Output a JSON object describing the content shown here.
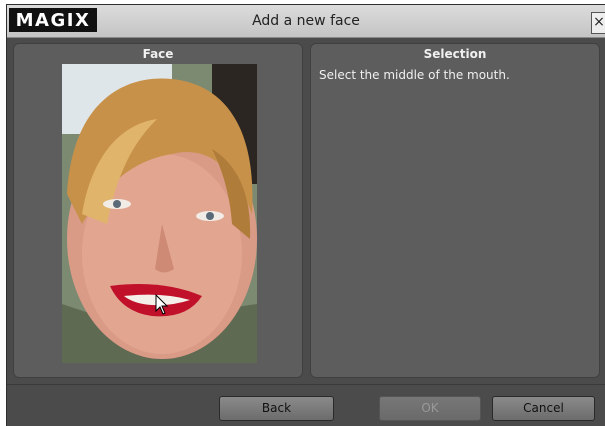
{
  "window": {
    "logo": "MAGIX",
    "title": "Add a new face",
    "close_glyph": "×"
  },
  "face_panel": {
    "title": "Face"
  },
  "selection_panel": {
    "title": "Selection",
    "instruction": "Select the middle of the mouth."
  },
  "buttons": {
    "back": "Back",
    "ok": "OK",
    "cancel": "Cancel"
  },
  "colors": {
    "dialog_bg": "#4b4b4b",
    "panel_bg": "#5d5d5d",
    "lip_red": "#c0102a"
  },
  "icons": {
    "close": "close-icon",
    "cursor": "mouse-pointer-icon"
  }
}
